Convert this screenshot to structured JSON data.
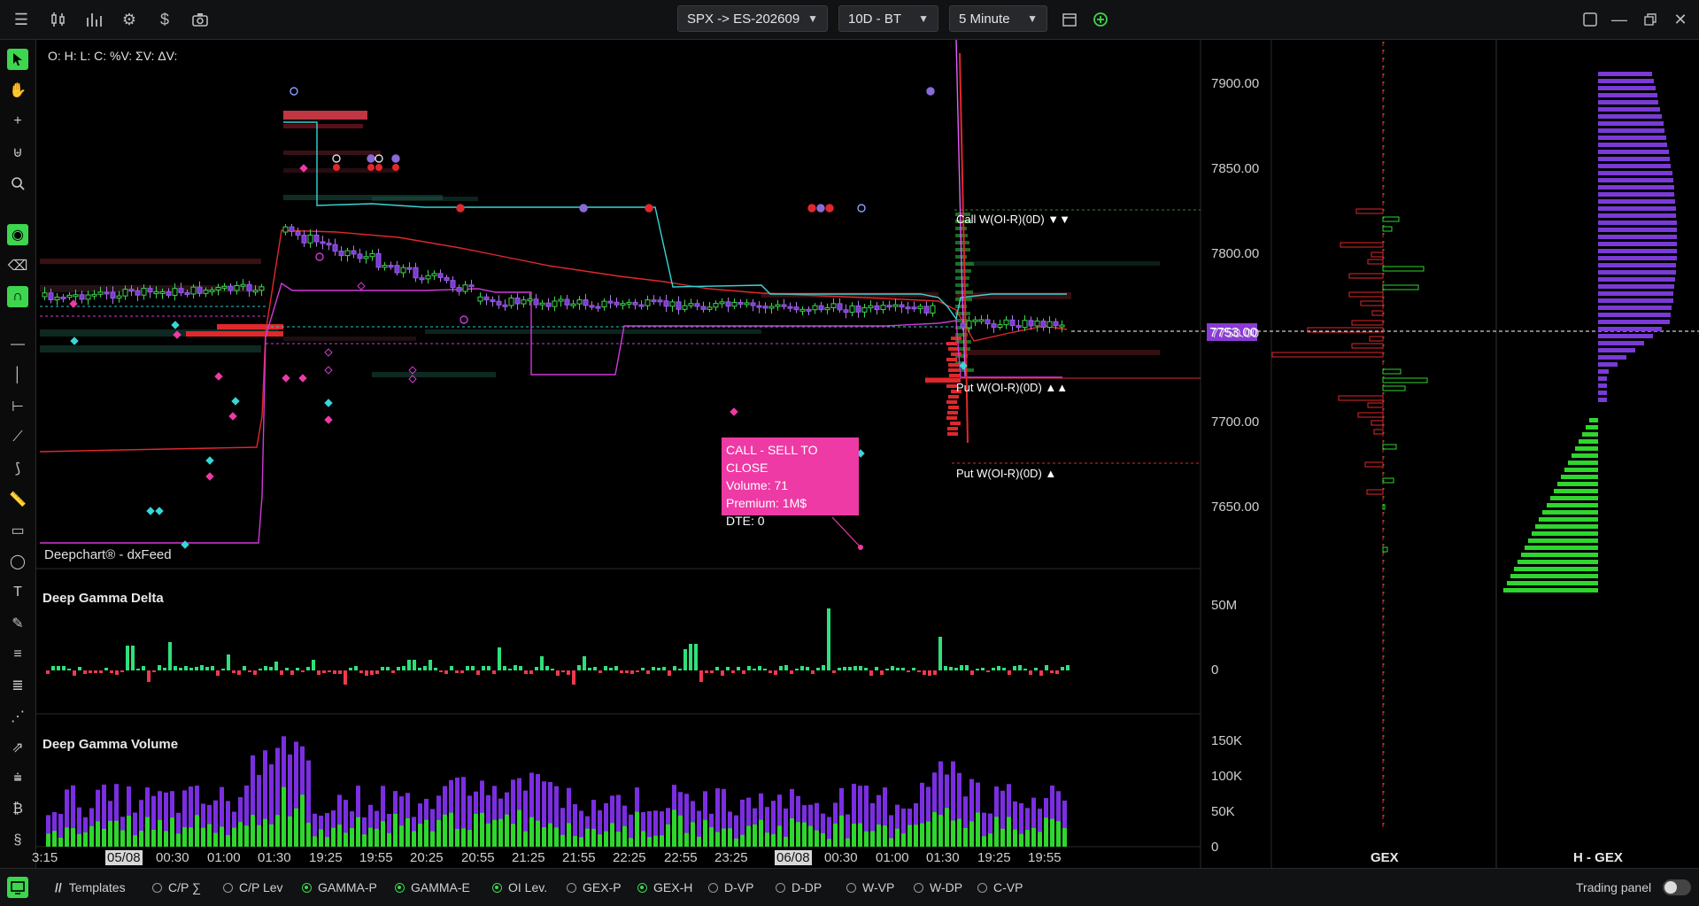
{
  "toolbar": {
    "symbol": "SPX -> ES-202609",
    "range": "10D - BT",
    "interval": "5 Minute"
  },
  "chart": {
    "ohlc_label": "O: H: L: C: %V: ΣV: ΔV:",
    "source_label": "Deepchart® - dxFeed",
    "price_ticks": [
      "7900.00",
      "7850.00",
      "7800.00",
      "7750.00",
      "7700.00",
      "7650.00"
    ],
    "current_price": "7753.00",
    "call_wall_label": "Call W(OI-R)(0D)",
    "put_wall_label_1": "Put W(OI-R)(0D)",
    "put_wall_label_2": "Put W(OI-R)(0D)",
    "time_labels": [
      "3:15",
      "05/08",
      "00:30",
      "01:00",
      "01:30",
      "19:25",
      "19:55",
      "20:25",
      "20:55",
      "21:25",
      "21:55",
      "22:25",
      "22:55",
      "23:25",
      "06/08",
      "00:30",
      "01:00",
      "01:30",
      "19:25",
      "19:55"
    ],
    "accent_green": "#3dd64e",
    "accent_red": "#e0282c",
    "accent_purple": "#8a3ad6"
  },
  "tooltip": {
    "line1": "CALL - SELL TO CLOSE",
    "line2": "Volume: 71",
    "line3": "Premium: 1M$",
    "line4": "DTE: 0"
  },
  "delta_panel": {
    "title": "Deep Gamma Delta",
    "ticks": [
      "50M",
      "0"
    ]
  },
  "volume_panel": {
    "title": "Deep Gamma Volume",
    "ticks": [
      "150K",
      "100K",
      "50K",
      "0"
    ]
  },
  "right_panels": {
    "gex_label": "GEX",
    "hgex_label": "H - GEX"
  },
  "bottom": {
    "templates_label": "Templates",
    "options": [
      {
        "label": "C/P ∑",
        "on": false
      },
      {
        "label": "C/P Lev",
        "on": false
      },
      {
        "label": "GAMMA-P",
        "on": true
      },
      {
        "label": "GAMMA-E",
        "on": true
      },
      {
        "label": "OI Lev.",
        "on": true
      },
      {
        "label": "GEX-P",
        "on": false
      },
      {
        "label": "GEX-H",
        "on": true
      },
      {
        "label": "D-VP",
        "on": false
      },
      {
        "label": "D-DP",
        "on": false
      },
      {
        "label": "W-VP",
        "on": false
      },
      {
        "label": "W-DP",
        "on": false
      },
      {
        "label": "C-VP",
        "on": false
      }
    ],
    "trading_panel_label": "Trading panel"
  }
}
